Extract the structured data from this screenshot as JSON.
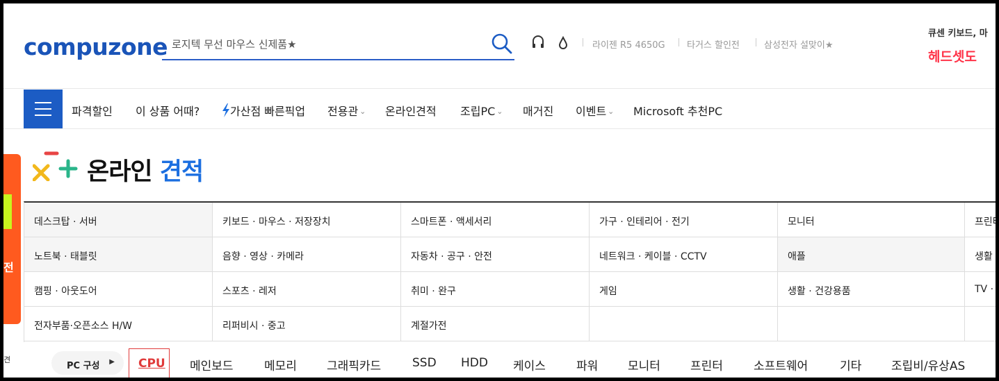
{
  "header": {
    "logo": "compuzone",
    "search_placeholder": "로지텍 무선 마우스 신제품★",
    "keywords": [
      "라이젠 R5 4650G",
      "타거스 할인전",
      "삼성전자 설맞이★"
    ],
    "promo_top": "큐센 키보드, 마",
    "promo_bottom": "헤드셋도"
  },
  "nav": {
    "items": [
      {
        "label": "파격할인",
        "dropdown": false
      },
      {
        "label": "이 상품 어때?",
        "dropdown": false
      },
      {
        "label": "가산점 빠른픽업",
        "dropdown": false
      },
      {
        "label": "전용관",
        "dropdown": true
      },
      {
        "label": "온라인견적",
        "dropdown": false
      },
      {
        "label": "조립PC",
        "dropdown": true
      },
      {
        "label": "매거진",
        "dropdown": false
      },
      {
        "label": "이벤트",
        "dropdown": true
      },
      {
        "label": "Microsoft 추천PC",
        "dropdown": false
      }
    ]
  },
  "side_banner": {
    "text": "전",
    "sub_text": "견"
  },
  "page_title": {
    "main": "온라인",
    "accent": "견적"
  },
  "categories": [
    [
      "데스크탑 · 서버",
      "키보드 · 마우스 · 저장장치",
      "스마트폰 · 액세서리",
      "가구 · 인테리어 · 전기",
      "모니터",
      "프린터"
    ],
    [
      "노트북 · 태블릿",
      "음향 · 영상 · 카메라",
      "자동차 · 공구 · 안전",
      "네트워크 · 케이블 · CCTV",
      "애플",
      "생활"
    ],
    [
      "캠핑 · 아웃도어",
      "스포츠 · 레저",
      "취미 · 완구",
      "게임",
      "생활 · 건강용품",
      "TV ·"
    ],
    [
      "전자부품·오픈소스 H/W",
      "리퍼비시 · 중고",
      "계절가전",
      "",
      "",
      ""
    ]
  ],
  "pc_build": {
    "label": "PC 구성",
    "active_tab": "CPU",
    "tabs": [
      "메인보드",
      "메모리",
      "그래픽카드",
      "SSD",
      "HDD",
      "케이스",
      "파워",
      "모니터",
      "프린터",
      "소프트웨어",
      "기타",
      "조립비/유상AS"
    ]
  },
  "colors": {
    "brand_blue": "#1a54b8",
    "accent_blue": "#1c6fe0",
    "active_red": "#e03a3a",
    "promo_red": "#ff3348",
    "side_orange": "#ff5a1f"
  }
}
